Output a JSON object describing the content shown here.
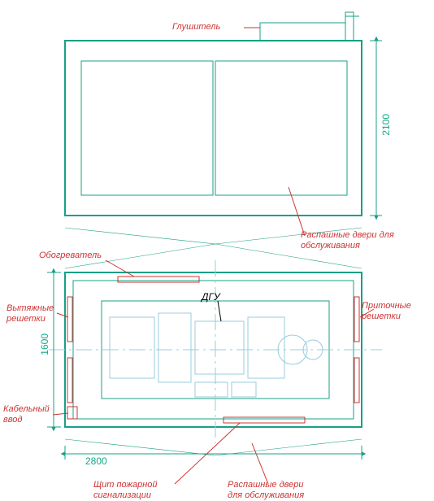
{
  "labels": {
    "muffler": "Глушитель",
    "heater": "Обогреватель",
    "exhaust_grilles": "Вытяжные\nрешетки",
    "cable_entry": "Кабельный\nввод",
    "fire_panel": "Щит пожарной\nсигнализации",
    "swing_doors_1": "Распашные двери\nдля обслуживания",
    "swing_doors_2": "Распашные двери\nдля обслуживания",
    "intake_grilles": "Приточные\nрешетки",
    "dgu": "ДГУ"
  },
  "dims": {
    "width_mm": "2800",
    "height_mm": "2100",
    "depth_mm": "1600"
  },
  "colors": {
    "outline": "#18a085",
    "accent": "#c33",
    "light": "#9cd"
  }
}
